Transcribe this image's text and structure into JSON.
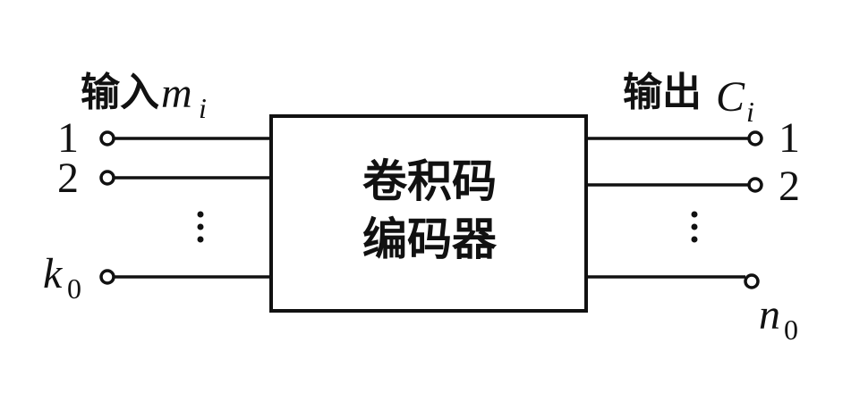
{
  "encoder": {
    "line1": "卷积码",
    "line2": "编码器"
  },
  "input": {
    "label": "输入",
    "symbol": "m",
    "subscript": "i",
    "ports": [
      "1",
      "2",
      "k",
      "0"
    ]
  },
  "output": {
    "label": "输出",
    "symbol": "C",
    "subscript": "i",
    "ports": [
      "1",
      "2",
      "n",
      "0"
    ]
  }
}
